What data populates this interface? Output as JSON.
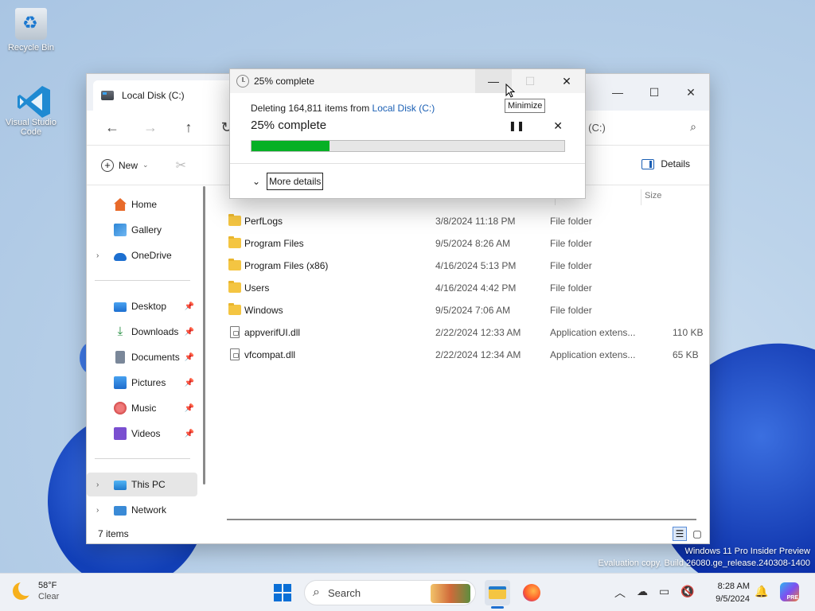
{
  "desktop": {
    "icons": [
      {
        "label": "Recycle Bin"
      },
      {
        "label": "Visual Studio Code"
      }
    ],
    "watermark": {
      "line1": "Windows 11 Pro Insider Preview",
      "line2": "Evaluation copy. Build 26080.ge_release.240308-1400"
    }
  },
  "explorer": {
    "tab_title": "Local Disk (C:)",
    "address_fragment": "k (C:)",
    "toolbar": {
      "new_label": "New",
      "details_label": "Details"
    },
    "sidebar": {
      "items": [
        {
          "label": "Home",
          "icon": "home-icon"
        },
        {
          "label": "Gallery",
          "icon": "gallery-icon"
        },
        {
          "label": "OneDrive",
          "icon": "onedrive-icon"
        },
        {
          "label": "Desktop",
          "icon": "desktop-icon"
        },
        {
          "label": "Downloads",
          "icon": "downloads-icon"
        },
        {
          "label": "Documents",
          "icon": "documents-icon"
        },
        {
          "label": "Pictures",
          "icon": "pictures-icon"
        },
        {
          "label": "Music",
          "icon": "music-icon"
        },
        {
          "label": "Videos",
          "icon": "videos-icon"
        },
        {
          "label": "This PC",
          "icon": "this-pc-icon"
        },
        {
          "label": "Network",
          "icon": "network-icon"
        }
      ]
    },
    "columns": {
      "size": "Size"
    },
    "files": [
      {
        "name": "PerfLogs",
        "date": "3/8/2024 11:18 PM",
        "type": "File folder",
        "size": ""
      },
      {
        "name": "Program Files",
        "date": "9/5/2024 8:26 AM",
        "type": "File folder",
        "size": ""
      },
      {
        "name": "Program Files (x86)",
        "date": "4/16/2024 5:13 PM",
        "type": "File folder",
        "size": ""
      },
      {
        "name": "Users",
        "date": "4/16/2024 4:42 PM",
        "type": "File folder",
        "size": ""
      },
      {
        "name": "Windows",
        "date": "9/5/2024 7:06 AM",
        "type": "File folder",
        "size": ""
      },
      {
        "name": "appverifUI.dll",
        "date": "2/22/2024 12:33 AM",
        "type": "Application extens...",
        "size": "110 KB"
      },
      {
        "name": "vfcompat.dll",
        "date": "2/22/2024 12:34 AM",
        "type": "Application extens...",
        "size": "65 KB"
      }
    ],
    "status": "7 items"
  },
  "progress_dialog": {
    "title": "25% complete",
    "desc_prefix": "Deleting 164,811 items from ",
    "desc_link": "Local Disk (C:)",
    "percent_text": "25% complete",
    "progress": 0.25,
    "more_details": "More details",
    "accent_color": "#06b025"
  },
  "tooltip": "Minimize",
  "taskbar": {
    "weather": {
      "temp": "58°F",
      "condition": "Clear"
    },
    "search_placeholder": "Search",
    "time": "8:28 AM",
    "date": "9/5/2024",
    "copilot_badge": "PRE"
  }
}
